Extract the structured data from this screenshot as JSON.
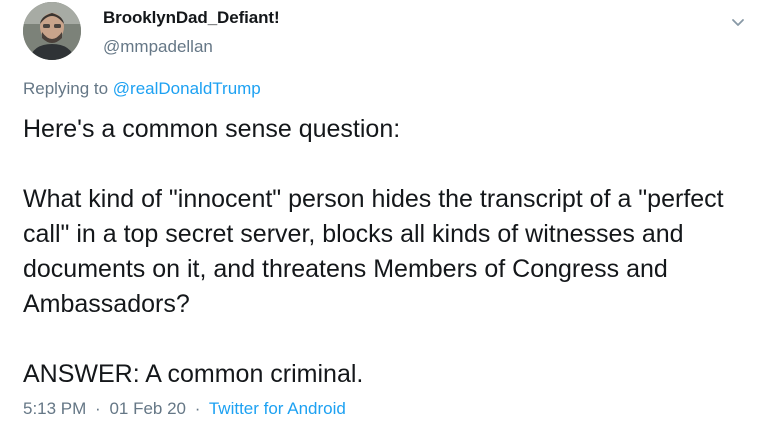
{
  "author": {
    "display_name": "BrooklynDad_Defiant!",
    "handle": "@mmpadellan",
    "avatar_icon": "user-avatar"
  },
  "reply": {
    "prefix": "Replying to",
    "mention": "@realDonaldTrump"
  },
  "tweet": {
    "paragraphs": [
      "Here's a common sense question:",
      "What kind of \"innocent\" person hides the transcript of a \"perfect call\" in a top secret server, blocks all kinds of witnesses and documents on it, and threatens Members of Congress and Ambassadors?",
      "ANSWER: A common criminal."
    ]
  },
  "meta": {
    "time": "5:13 PM",
    "separator": "·",
    "date": "01 Feb 20",
    "source": "Twitter for Android"
  },
  "colors": {
    "text": "#14171a",
    "secondary": "#657786",
    "link": "#1da1f2"
  },
  "icons": {
    "menu": "chevron-down-icon"
  }
}
